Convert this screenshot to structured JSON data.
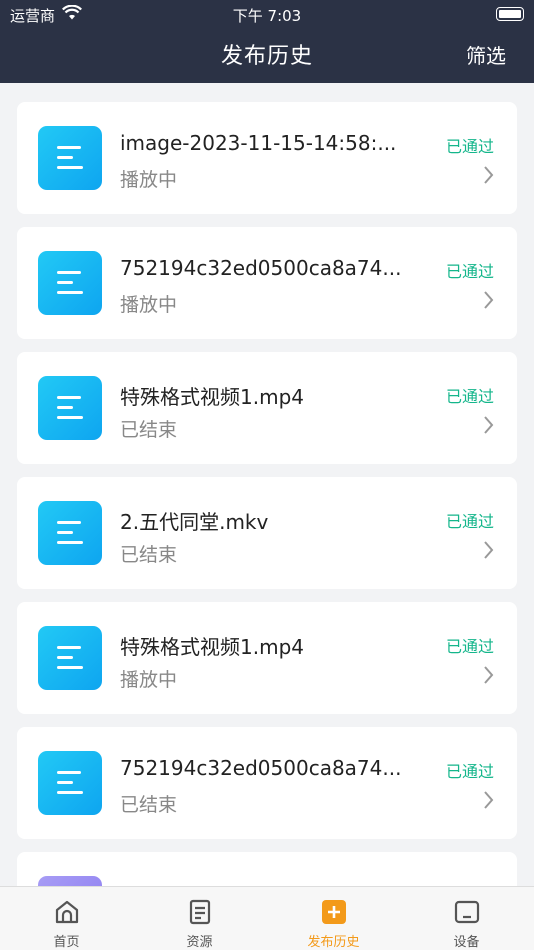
{
  "status_bar": {
    "carrier": "运营商",
    "time": "下午 7:03"
  },
  "header": {
    "title": "发布历史",
    "filter_label": "筛选"
  },
  "items": [
    {
      "name": "image-2023-11-15-14:58:...",
      "state": "播放中",
      "badge": "已通过"
    },
    {
      "name": "752194c32ed0500ca8a74...",
      "state": "播放中",
      "badge": "已通过"
    },
    {
      "name": "特殊格式视频1.mp4",
      "state": "已结束",
      "badge": "已通过"
    },
    {
      "name": "2.五代同堂.mkv",
      "state": "已结束",
      "badge": "已通过"
    },
    {
      "name": "特殊格式视频1.mp4",
      "state": "播放中",
      "badge": "已通过"
    },
    {
      "name": "752194c32ed0500ca8a74...",
      "state": "已结束",
      "badge": "已通过"
    },
    {
      "name": "",
      "state": "",
      "badge": ""
    }
  ],
  "tabs": [
    {
      "label": "首页",
      "icon": "home-icon"
    },
    {
      "label": "资源",
      "icon": "document-icon"
    },
    {
      "label": "发布历史",
      "icon": "plus-icon",
      "active": true
    },
    {
      "label": "设备",
      "icon": "device-icon"
    }
  ],
  "colors": {
    "header_bg": "#2b3245",
    "accent": "#f39a1a",
    "approved": "#14b68b",
    "thumb": "#1ab4f2"
  }
}
